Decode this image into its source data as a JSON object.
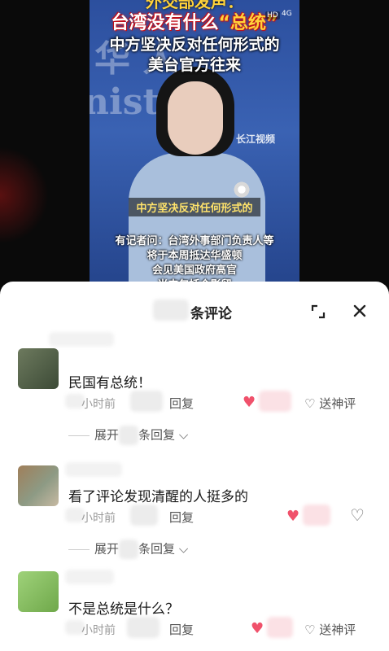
{
  "video": {
    "title_top": "外交部发声：",
    "title_line2_pre": "台湾没有什么",
    "title_line2_hl": "“总统”",
    "title_line3": "中方坚决反对任何形式的",
    "title_line4": "美台官方往来",
    "bg_text": "nist   Fo",
    "bg_text_top": "华 人",
    "watermark": "长江视频",
    "status_hd": "HD",
    "status_net": "4G",
    "caption": "中方坚决反对任何形式的",
    "lower_lines": [
      "有记者问：台湾外事部门负责人等",
      "将于本周抵达华盛顿",
      "会见美国政府高官",
      "当中包括合影留"
    ]
  },
  "sheet": {
    "title_suffix": "条评论",
    "expand_icon": "expand-icon",
    "close_icon": "close-icon"
  },
  "comments": [
    {
      "text": "民国有总统！",
      "time": "小时前",
      "reply_label": "回复",
      "send_label": "送神评",
      "expand_label": "展开",
      "expand_suffix": "条回复",
      "liked": true
    },
    {
      "text": "看了评论发现清醒的人挺多的",
      "time": "小时前",
      "reply_label": "回复",
      "expand_label": "展开",
      "expand_suffix": "条回复",
      "liked": true
    },
    {
      "text": "不是总统是什么？",
      "time": "小时前",
      "reply_label": "回复",
      "send_label": "送神评",
      "liked": true
    }
  ],
  "colors": {
    "heart": "#f0516b",
    "accent_video": "#2c4f9e"
  }
}
